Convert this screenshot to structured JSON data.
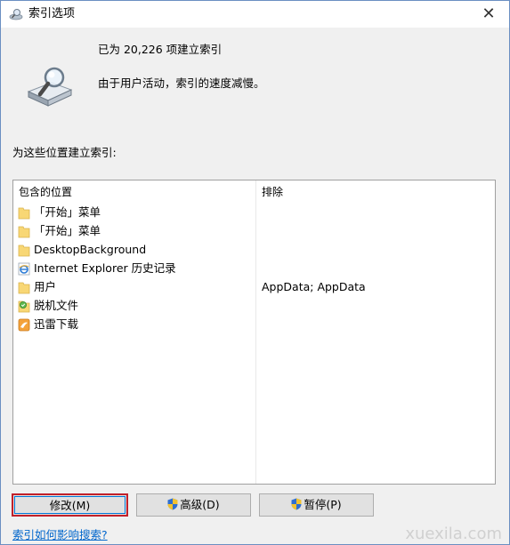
{
  "window": {
    "title": "索引选项",
    "close_glyph": "✕"
  },
  "summary": {
    "count_text": "已为 20,226 项建立索引",
    "status_text": "由于用户活动，索引的速度减慢。"
  },
  "locations": {
    "section_label": "为这些位置建立索引:",
    "headers": {
      "included": "包含的位置",
      "excluded": "排除"
    },
    "rows": [
      {
        "icon": "folder-icon",
        "label": "「开始」菜单",
        "exclude": ""
      },
      {
        "icon": "folder-icon",
        "label": "「开始」菜单",
        "exclude": ""
      },
      {
        "icon": "folder-icon",
        "label": "DesktopBackground",
        "exclude": ""
      },
      {
        "icon": "ie-icon",
        "label": "Internet Explorer 历史记录",
        "exclude": ""
      },
      {
        "icon": "folder-icon",
        "label": "用户",
        "exclude": "AppData; AppData"
      },
      {
        "icon": "offline-files-icon",
        "label": "脱机文件",
        "exclude": ""
      },
      {
        "icon": "thunder-icon",
        "label": "迅雷下载",
        "exclude": ""
      }
    ]
  },
  "buttons": {
    "modify": "修改(M)",
    "advanced": "高级(D)",
    "pause": "暂停(P)"
  },
  "help_link": "索引如何影响搜索?",
  "watermark": "xuexila.com",
  "colors": {
    "link": "#0066cc",
    "focus_border": "#c0202a",
    "folder": "#f8d775"
  }
}
